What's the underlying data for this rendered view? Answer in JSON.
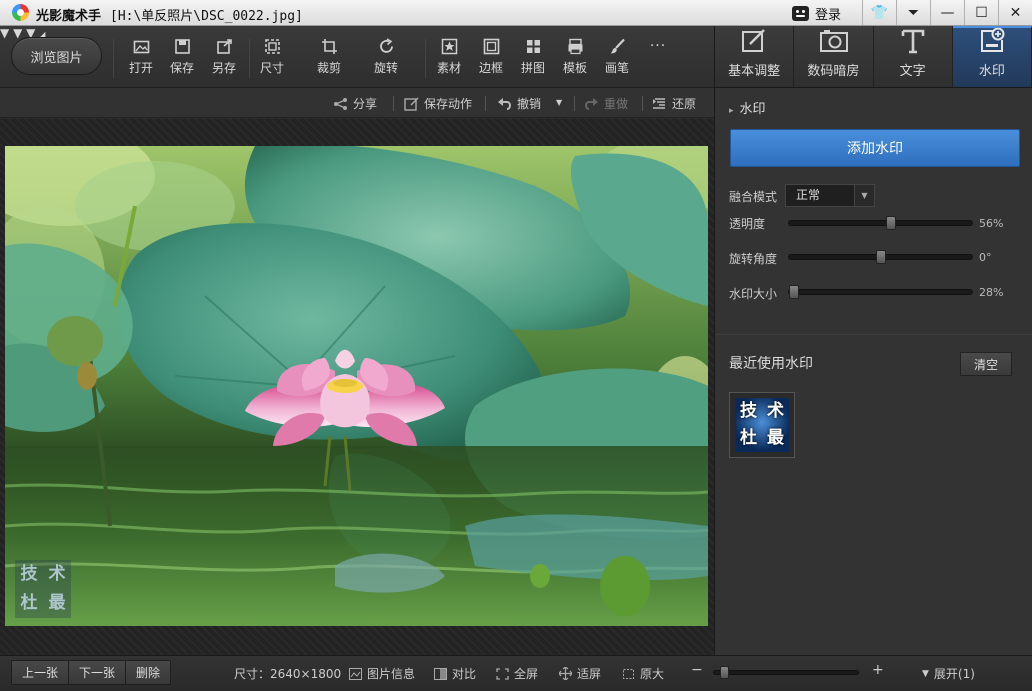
{
  "titlebar": {
    "app_name": "光影魔术手",
    "file_path": "[H:\\单反照片\\DSC_0022.jpg]",
    "login_label": "登录",
    "buttons": [
      "shirt-icon",
      "dropdown-icon",
      "minimize-icon",
      "maximize-icon",
      "close-icon"
    ]
  },
  "toolbar": {
    "browse_label": "浏览图片",
    "tools": [
      {
        "label": "打开",
        "icon": "open-image-icon"
      },
      {
        "label": "保存",
        "icon": "save-icon"
      },
      {
        "label": "另存",
        "icon": "save-as-icon"
      },
      {
        "label": "尺寸",
        "icon": "resize-icon"
      },
      {
        "label": "裁剪",
        "icon": "crop-icon"
      },
      {
        "label": "旋转",
        "icon": "rotate-icon"
      },
      {
        "label": "素材",
        "icon": "material-icon"
      },
      {
        "label": "边框",
        "icon": "border-icon"
      },
      {
        "label": "拼图",
        "icon": "collage-icon"
      },
      {
        "label": "模板",
        "icon": "template-icon"
      },
      {
        "label": "画笔",
        "icon": "brush-icon"
      }
    ],
    "more_label": "···"
  },
  "subbar": {
    "share_label": "分享",
    "save_action_label": "保存动作",
    "undo_label": "撤销",
    "redo_label": "重做",
    "restore_label": "还原"
  },
  "right_tabs": [
    {
      "label": "基本调整",
      "icon": "basic-adjust-icon",
      "active": false
    },
    {
      "label": "数码暗房",
      "icon": "darkroom-icon",
      "active": false
    },
    {
      "label": "文字",
      "icon": "text-icon",
      "active": false
    },
    {
      "label": "水印",
      "icon": "watermark-icon",
      "active": true
    }
  ],
  "panel": {
    "section_title": "水印",
    "add_watermark_label": "添加水印",
    "blend_mode_label": "融合模式",
    "blend_mode_value": "正常",
    "opacity_label": "透明度",
    "opacity_value": "56%",
    "opacity_fraction": 0.56,
    "rotation_label": "旋转角度",
    "rotation_value": "0°",
    "rotation_fraction": 0.5,
    "size_label": "水印大小",
    "size_value": "28%",
    "size_fraction": 0.0,
    "recent_title": "最近使用水印",
    "clear_label": "清空",
    "watermark_chars": [
      "技",
      "术",
      "杜",
      "最"
    ]
  },
  "photo": {
    "watermark_chars": [
      "技",
      "术",
      "杜",
      "最"
    ]
  },
  "bottombar": {
    "prev_label": "上一张",
    "next_label": "下一张",
    "delete_label": "删除",
    "size_label": "尺寸：2640×1800",
    "image_info_label": "图片信息",
    "compare_label": "对比",
    "fullscreen_label": "全屏",
    "fit_label": "适屏",
    "original_label": "原大",
    "zoom_minus": "−",
    "zoom_plus": "+",
    "expand_label": "展开(1)"
  }
}
